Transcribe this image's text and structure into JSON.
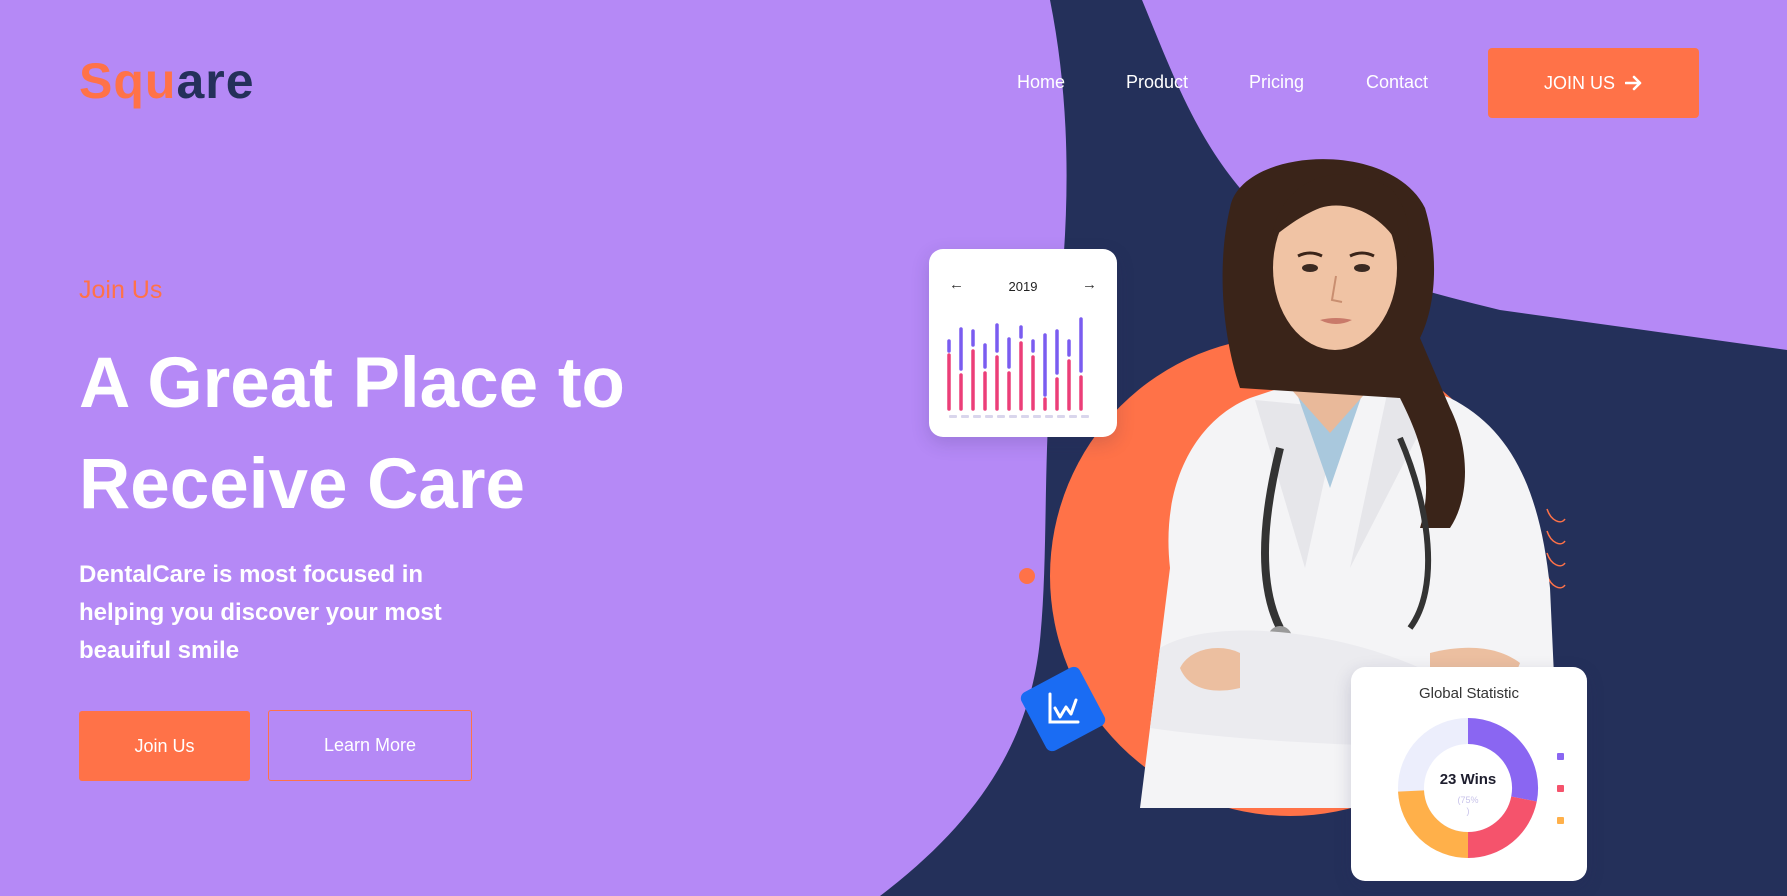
{
  "brand": {
    "logo_part1": "Squ",
    "logo_part2": "are"
  },
  "nav": {
    "items": [
      {
        "label": "Home"
      },
      {
        "label": "Product"
      },
      {
        "label": "Pricing"
      },
      {
        "label": "Contact"
      }
    ],
    "cta_label": "JOIN US"
  },
  "hero": {
    "eyebrow": "Join Us",
    "title_line1": "A Great Place to",
    "title_line2": "Receive Care",
    "description": "DentalCare is most focused in helping you discover your most beauiful smile",
    "primary_button": "Join Us",
    "secondary_button": "Learn More"
  },
  "chart_card": {
    "year": "2019",
    "prev_icon": "←",
    "next_icon": "→"
  },
  "stat_card": {
    "title": "Global Statistic",
    "center_label": "23 Wins",
    "center_sub": "(75%",
    "center_sub2": ")"
  },
  "icons": {
    "join_arrow": "arrow-right-icon",
    "badge": "chart-line-icon"
  },
  "colors": {
    "background": "#b589f6",
    "navy": "#24305a",
    "accent": "#ff7248",
    "badge_blue": "#1a6cf3"
  }
}
